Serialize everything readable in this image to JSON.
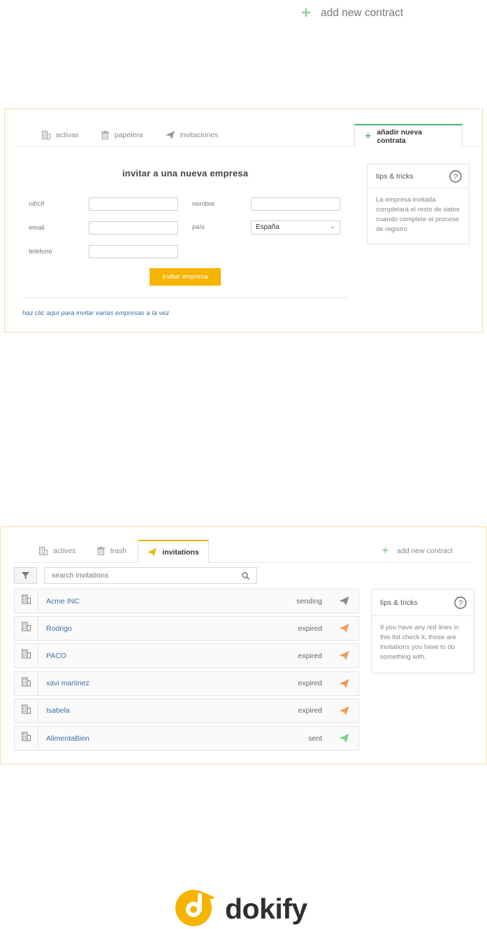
{
  "top_button": {
    "label": "add new contract"
  },
  "panel_es": {
    "tabs": [
      {
        "label": "activas"
      },
      {
        "label": "papelera"
      },
      {
        "label": "invitaciones"
      }
    ],
    "active_tab": {
      "label": "añadir nueva contrata"
    },
    "form": {
      "title": "invitar a una nueva empresa",
      "nif_label": "nif/cif",
      "nif_value": "",
      "nombre_label": "nombre",
      "nombre_value": "",
      "email_label": "email",
      "email_value": "",
      "pais_label": "país",
      "pais_selected": "España",
      "telefono_label": "teléfono",
      "telefono_value": "",
      "submit_label": "invitar empresa",
      "bulk_link": "haz clic aquí para invitar varias empresas a la vez"
    },
    "tips": {
      "title": "tips & tricks",
      "body": "La empresa invitada completará el resto de datos cuando complete el proceso de registro"
    }
  },
  "panel_en": {
    "tabs": [
      {
        "label": "actives"
      },
      {
        "label": "trash"
      }
    ],
    "active_tab": {
      "label": "invitations"
    },
    "add_contract": {
      "label": "add new contract"
    },
    "search": {
      "placeholder": "search invitations"
    },
    "invitations": [
      {
        "name": "Acme INC",
        "status": "sending",
        "icon_color": "#8a8a8a"
      },
      {
        "name": "Rodrigo",
        "status": "expired",
        "icon_color": "#f39a55"
      },
      {
        "name": "PACO",
        "status": "expired",
        "icon_color": "#f39a55"
      },
      {
        "name": "xavi martinez",
        "status": "expired",
        "icon_color": "#f39a55"
      },
      {
        "name": "Isabela",
        "status": "expired",
        "icon_color": "#f39a55"
      },
      {
        "name": "AlimentaBien",
        "status": "sent",
        "icon_color": "#7fcf8c"
      }
    ],
    "tips": {
      "title": "tips & tricks",
      "body": "If you have any red lines in this list check it, those are invitations you have to do something with."
    }
  },
  "logo": {
    "text": "dokify",
    "color": "#f5b400"
  }
}
